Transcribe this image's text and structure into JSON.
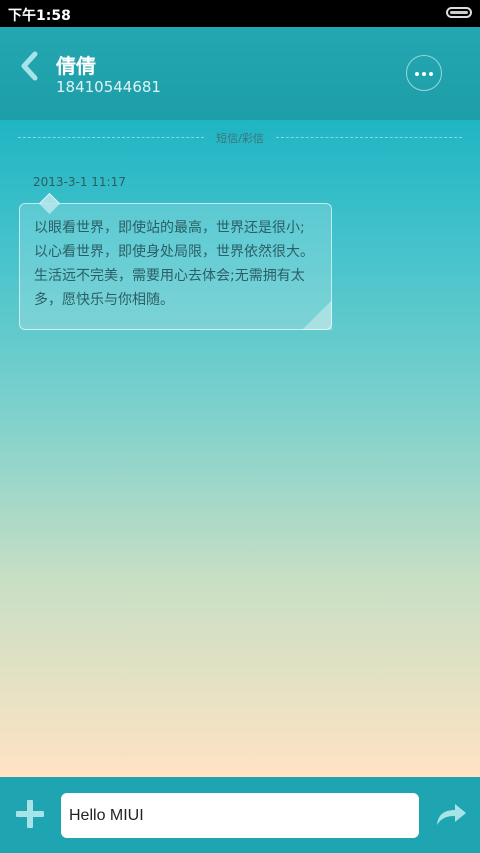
{
  "status_bar": {
    "time": "下午1:58",
    "battery_icon": "battery-icon"
  },
  "header": {
    "contact_name": "倩倩",
    "contact_number": "18410544681",
    "back_icon": "chevron-left-icon",
    "more_icon": "more-dots-icon"
  },
  "conversation": {
    "section_label": "短信/彩信",
    "messages": [
      {
        "timestamp": "2013-3-1 11:17",
        "text": "以眼看世界，即使站的最高，世界还是很小;以心看世界，即使身处局限，世界依然很大。生活远不完美，需要用心去体会;无需拥有太多，愿快乐与你相随。"
      }
    ]
  },
  "composer": {
    "value": "Hello MIUI",
    "attach_icon": "plus-icon",
    "send_icon": "send-arrow-icon"
  },
  "colors": {
    "accent": "#1ea5b1",
    "header": "#23a7b1"
  }
}
